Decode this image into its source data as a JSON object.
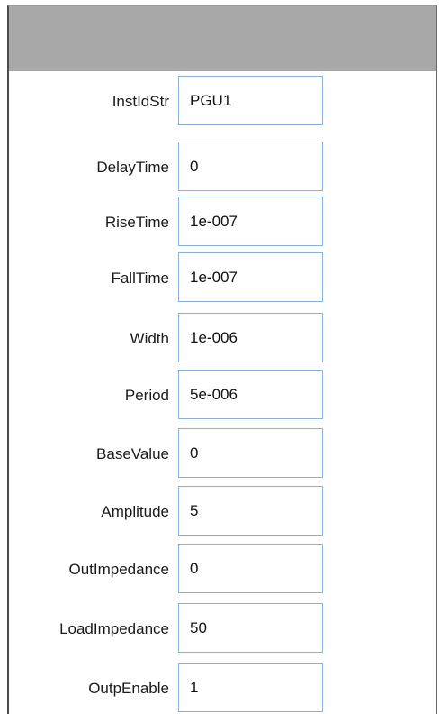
{
  "fields": [
    {
      "label": "InstIdStr",
      "value": "PGU1"
    },
    {
      "label": "DelayTime",
      "value": "0"
    },
    {
      "label": "RiseTime",
      "value": "1e-007"
    },
    {
      "label": "FallTime",
      "value": "1e-007"
    },
    {
      "label": "Width",
      "value": "1e-006"
    },
    {
      "label": "Period",
      "value": "5e-006"
    },
    {
      "label": "BaseValue",
      "value": "0"
    },
    {
      "label": "Amplitude",
      "value": "5"
    },
    {
      "label": "OutImpedance",
      "value": "0"
    },
    {
      "label": "LoadImpedance",
      "value": "50"
    },
    {
      "label": "OutpEnable",
      "value": "1"
    }
  ],
  "colors": {
    "header": "#a8a8a8",
    "field_border": "#8ab0d6"
  }
}
